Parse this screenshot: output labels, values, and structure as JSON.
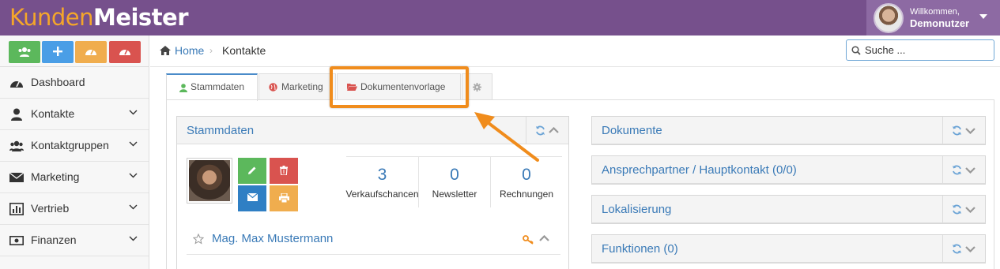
{
  "app": {
    "logo_part1": "Kunden",
    "logo_part2": "Meister",
    "welcome": "Willkommen,",
    "username": "Demonutzer"
  },
  "colors": {
    "topbar": "#76508c",
    "accent_orange": "#f08c1c",
    "link_blue": "#3a7ab7",
    "btn_green": "#5cb85c",
    "btn_blue": "#4a9ee6",
    "btn_yellow": "#f0ad4e",
    "btn_red": "#d9534f"
  },
  "quick_buttons": [
    {
      "icon": "users-icon"
    },
    {
      "icon": "plus-icon"
    },
    {
      "icon": "dashboard-icon"
    },
    {
      "icon": "dashboard-icon"
    }
  ],
  "sidebar": {
    "items": [
      {
        "label": "Dashboard",
        "icon": "dashboard-icon"
      },
      {
        "label": "Kontakte",
        "icon": "user-icon"
      },
      {
        "label": "Kontaktgruppen",
        "icon": "users-icon"
      },
      {
        "label": "Marketing",
        "icon": "envelope-icon"
      },
      {
        "label": "Vertrieb",
        "icon": "bar-chart-icon"
      },
      {
        "label": "Finanzen",
        "icon": "money-icon"
      }
    ]
  },
  "breadcrumb": {
    "home": "Home",
    "current": "Kontakte"
  },
  "search": {
    "placeholder": "Suche ..."
  },
  "tabs": [
    {
      "label": "Stammdaten",
      "icon": "user-icon",
      "active": true
    },
    {
      "label": "Marketing",
      "icon": "globe-icon",
      "active": false
    },
    {
      "label": "Dokumentenvorlage",
      "icon": "folder-open-icon",
      "active": false
    },
    {
      "label": "",
      "icon": "gear-icon",
      "active": false
    }
  ],
  "stammdaten_panel": {
    "title": "Stammdaten",
    "stats": [
      {
        "value": "3",
        "label": "Verkaufschancen"
      },
      {
        "value": "0",
        "label": "Newsletter"
      },
      {
        "value": "0",
        "label": "Rechnungen"
      }
    ],
    "contact_name": "Mag. Max Mustermann"
  },
  "right_panels": [
    {
      "title": "Dokumente"
    },
    {
      "title": "Ansprechpartner / Hauptkontakt (0/0)"
    },
    {
      "title": "Lokalisierung"
    },
    {
      "title": "Funktionen (0)"
    }
  ]
}
